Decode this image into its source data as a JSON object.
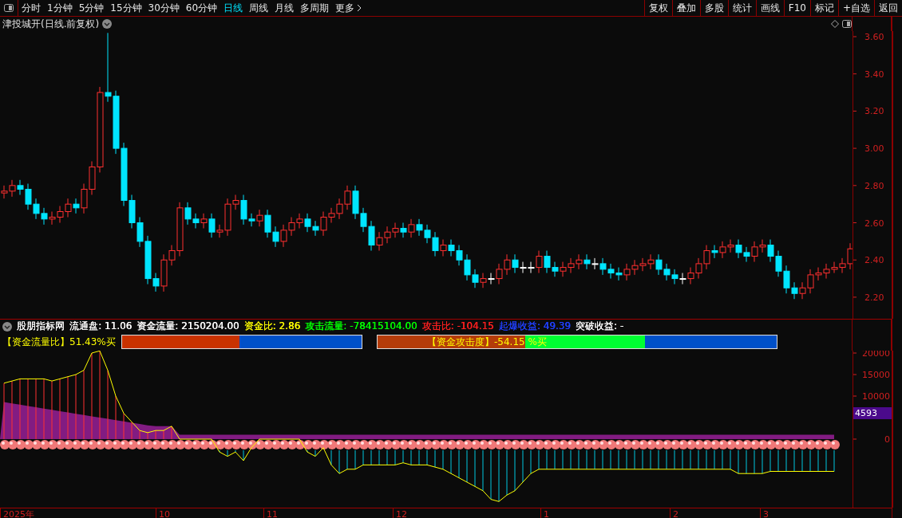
{
  "toolbar": {
    "tabs": [
      {
        "label": "分时",
        "selected": false
      },
      {
        "label": "1分钟",
        "selected": false
      },
      {
        "label": "5分钟",
        "selected": false
      },
      {
        "label": "15分钟",
        "selected": false
      },
      {
        "label": "30分钟",
        "selected": false
      },
      {
        "label": "60分钟",
        "selected": false
      },
      {
        "label": "日线",
        "selected": true
      },
      {
        "label": "周线",
        "selected": false
      },
      {
        "label": "月线",
        "selected": false
      },
      {
        "label": "多周期",
        "selected": false
      },
      {
        "label": "更多",
        "selected": false
      }
    ],
    "buttons": [
      "复权",
      "叠加",
      "多股",
      "统计",
      "画线",
      "F10",
      "标记",
      "+自选",
      "返回"
    ]
  },
  "chart": {
    "title": "津投城开(日线.前复权)",
    "chart_data": {
      "type": "candlestick",
      "ylim": [
        2.084,
        3.63
      ],
      "yticks": [
        {
          "value": 3.6,
          "label": "3.60"
        },
        {
          "value": 3.4,
          "label": "3.40"
        },
        {
          "value": 3.2,
          "label": "3.20"
        },
        {
          "value": 3.0,
          "label": "3.00"
        },
        {
          "value": 2.8,
          "label": "2.80"
        },
        {
          "value": 2.6,
          "label": "2.60"
        },
        {
          "value": 2.4,
          "label": "2.40"
        },
        {
          "value": 2.2,
          "label": "2.20"
        }
      ],
      "ohlc": [
        [
          2.76,
          2.8,
          2.73,
          2.77
        ],
        [
          2.77,
          2.83,
          2.74,
          2.8
        ],
        [
          2.8,
          2.83,
          2.75,
          2.78
        ],
        [
          2.78,
          2.81,
          2.67,
          2.7
        ],
        [
          2.7,
          2.73,
          2.62,
          2.65
        ],
        [
          2.65,
          2.68,
          2.59,
          2.62
        ],
        [
          2.62,
          2.66,
          2.59,
          2.63
        ],
        [
          2.63,
          2.69,
          2.6,
          2.66
        ],
        [
          2.66,
          2.73,
          2.63,
          2.7
        ],
        [
          2.7,
          2.73,
          2.65,
          2.68
        ],
        [
          2.68,
          2.81,
          2.65,
          2.78
        ],
        [
          2.78,
          2.93,
          2.75,
          2.9
        ],
        [
          2.9,
          3.33,
          2.87,
          3.3
        ],
        [
          3.3,
          3.62,
          3.25,
          3.28
        ],
        [
          3.28,
          3.31,
          2.97,
          3.0
        ],
        [
          3.0,
          3.03,
          2.69,
          2.72
        ],
        [
          2.72,
          2.75,
          2.57,
          2.6
        ],
        [
          2.6,
          2.63,
          2.47,
          2.5
        ],
        [
          2.5,
          2.53,
          2.27,
          2.3
        ],
        [
          2.3,
          2.33,
          2.23,
          2.26
        ],
        [
          2.26,
          2.43,
          2.23,
          2.4
        ],
        [
          2.4,
          2.48,
          2.37,
          2.45
        ],
        [
          2.45,
          2.71,
          2.42,
          2.68
        ],
        [
          2.68,
          2.71,
          2.59,
          2.62
        ],
        [
          2.62,
          2.65,
          2.57,
          2.6
        ],
        [
          2.6,
          2.65,
          2.57,
          2.62
        ],
        [
          2.62,
          2.65,
          2.52,
          2.55
        ],
        [
          2.55,
          2.59,
          2.52,
          2.56
        ],
        [
          2.56,
          2.73,
          2.53,
          2.7
        ],
        [
          2.7,
          2.75,
          2.67,
          2.72
        ],
        [
          2.72,
          2.75,
          2.59,
          2.62
        ],
        [
          2.62,
          2.65,
          2.58,
          2.61
        ],
        [
          2.61,
          2.67,
          2.58,
          2.64
        ],
        [
          2.64,
          2.67,
          2.52,
          2.55
        ],
        [
          2.55,
          2.58,
          2.47,
          2.5
        ],
        [
          2.5,
          2.59,
          2.47,
          2.56
        ],
        [
          2.56,
          2.63,
          2.53,
          2.6
        ],
        [
          2.6,
          2.65,
          2.57,
          2.62
        ],
        [
          2.62,
          2.65,
          2.55,
          2.58
        ],
        [
          2.58,
          2.61,
          2.53,
          2.56
        ],
        [
          2.56,
          2.66,
          2.53,
          2.63
        ],
        [
          2.63,
          2.68,
          2.6,
          2.65
        ],
        [
          2.65,
          2.73,
          2.62,
          2.7
        ],
        [
          2.7,
          2.8,
          2.67,
          2.77
        ],
        [
          2.77,
          2.8,
          2.62,
          2.65
        ],
        [
          2.65,
          2.68,
          2.55,
          2.58
        ],
        [
          2.58,
          2.61,
          2.45,
          2.48
        ],
        [
          2.48,
          2.55,
          2.45,
          2.52
        ],
        [
          2.52,
          2.58,
          2.49,
          2.55
        ],
        [
          2.55,
          2.6,
          2.52,
          2.57
        ],
        [
          2.57,
          2.6,
          2.52,
          2.55
        ],
        [
          2.55,
          2.62,
          2.52,
          2.59
        ],
        [
          2.59,
          2.62,
          2.53,
          2.56
        ],
        [
          2.56,
          2.59,
          2.49,
          2.52
        ],
        [
          2.52,
          2.55,
          2.42,
          2.45
        ],
        [
          2.45,
          2.51,
          2.42,
          2.48
        ],
        [
          2.48,
          2.51,
          2.42,
          2.45
        ],
        [
          2.45,
          2.48,
          2.37,
          2.4
        ],
        [
          2.4,
          2.43,
          2.29,
          2.32
        ],
        [
          2.32,
          2.35,
          2.25,
          2.28
        ],
        [
          2.28,
          2.33,
          2.25,
          2.3
        ],
        [
          2.3,
          2.33,
          2.27,
          2.3
        ],
        [
          2.3,
          2.38,
          2.27,
          2.35
        ],
        [
          2.35,
          2.43,
          2.32,
          2.4
        ],
        [
          2.4,
          2.43,
          2.33,
          2.36
        ],
        [
          2.36,
          2.39,
          2.33,
          2.36
        ],
        [
          2.36,
          2.39,
          2.33,
          2.36
        ],
        [
          2.36,
          2.45,
          2.33,
          2.42
        ],
        [
          2.42,
          2.45,
          2.33,
          2.36
        ],
        [
          2.36,
          2.39,
          2.31,
          2.34
        ],
        [
          2.34,
          2.39,
          2.31,
          2.36
        ],
        [
          2.36,
          2.41,
          2.33,
          2.38
        ],
        [
          2.38,
          2.43,
          2.35,
          2.4
        ],
        [
          2.4,
          2.43,
          2.35,
          2.38
        ],
        [
          2.38,
          2.41,
          2.35,
          2.38
        ],
        [
          2.38,
          2.41,
          2.32,
          2.35
        ],
        [
          2.35,
          2.38,
          2.3,
          2.33
        ],
        [
          2.33,
          2.36,
          2.29,
          2.32
        ],
        [
          2.32,
          2.38,
          2.29,
          2.35
        ],
        [
          2.35,
          2.4,
          2.32,
          2.37
        ],
        [
          2.37,
          2.41,
          2.34,
          2.38
        ],
        [
          2.38,
          2.43,
          2.35,
          2.4
        ],
        [
          2.4,
          2.43,
          2.32,
          2.35
        ],
        [
          2.35,
          2.38,
          2.29,
          2.32
        ],
        [
          2.32,
          2.35,
          2.27,
          2.3
        ],
        [
          2.3,
          2.33,
          2.27,
          2.3
        ],
        [
          2.3,
          2.36,
          2.27,
          2.33
        ],
        [
          2.33,
          2.41,
          2.3,
          2.38
        ],
        [
          2.38,
          2.48,
          2.35,
          2.45
        ],
        [
          2.45,
          2.48,
          2.41,
          2.44
        ],
        [
          2.44,
          2.5,
          2.41,
          2.47
        ],
        [
          2.47,
          2.51,
          2.44,
          2.48
        ],
        [
          2.48,
          2.51,
          2.41,
          2.44
        ],
        [
          2.44,
          2.47,
          2.39,
          2.42
        ],
        [
          2.42,
          2.5,
          2.39,
          2.47
        ],
        [
          2.47,
          2.51,
          2.44,
          2.48
        ],
        [
          2.48,
          2.51,
          2.39,
          2.42
        ],
        [
          2.42,
          2.45,
          2.31,
          2.34
        ],
        [
          2.34,
          2.37,
          2.22,
          2.25
        ],
        [
          2.25,
          2.28,
          2.19,
          2.22
        ],
        [
          2.22,
          2.28,
          2.19,
          2.25
        ],
        [
          2.25,
          2.35,
          2.22,
          2.32
        ],
        [
          2.32,
          2.36,
          2.29,
          2.33
        ],
        [
          2.33,
          2.38,
          2.3,
          2.35
        ],
        [
          2.35,
          2.39,
          2.33,
          2.36
        ],
        [
          2.36,
          2.41,
          2.33,
          2.38
        ],
        [
          2.38,
          2.49,
          2.35,
          2.46
        ]
      ]
    }
  },
  "indicator": {
    "items": [
      {
        "text": "股朋指标网",
        "color": "#ffffff"
      },
      {
        "text": "流通盘: 11.06",
        "color": "#ffffff"
      },
      {
        "text": "资金流量: 2150204.00",
        "color": "#ffffff"
      },
      {
        "text": "资金比: 2.86",
        "color": "#ffff00"
      },
      {
        "text": "攻击流量: -78415104.00",
        "color": "#00ff00"
      },
      {
        "text": "攻击比: -104.15",
        "color": "#ff2020"
      },
      {
        "text": "起爆收益: 49.39",
        "color": "#2040ff"
      },
      {
        "text": "突破收益: -",
        "color": "#ffffff"
      }
    ]
  },
  "flow_bar": {
    "label": "【资金流量比】51.43%买",
    "segments": [
      {
        "color": "#c83200",
        "level": 0.49
      },
      {
        "color": "#0050c8",
        "level": 0.51
      }
    ]
  },
  "attack_bar": {
    "label": "【资金攻击度】-54.15 %买",
    "segments": [
      {
        "color": "#b43c0a"
      },
      {
        "color": "#00ff32"
      },
      {
        "color": "#0050c8"
      }
    ]
  },
  "lower_chart": {
    "badge": "4593",
    "chart_data": {
      "type": "line",
      "ylim": [
        -15926,
        24630
      ],
      "categories": [
        null,
        null,
        null,
        null,
        null,
        null,
        null,
        null,
        null,
        null,
        null,
        null,
        null,
        null,
        null,
        null,
        null,
        null,
        null,
        null,
        null,
        null,
        null,
        null,
        null,
        null,
        null,
        null,
        null,
        null,
        null,
        null,
        null,
        null,
        null,
        null,
        null,
        null,
        null,
        null,
        null,
        null,
        null,
        null,
        null,
        null,
        null,
        null,
        null,
        null,
        null,
        null,
        null,
        null,
        null,
        null,
        null,
        null,
        null,
        null,
        null,
        null,
        null,
        null,
        null,
        null,
        null,
        null,
        null,
        null,
        null,
        null,
        null,
        null,
        null,
        null,
        null,
        null,
        null,
        null,
        null,
        null,
        null,
        null,
        null,
        null,
        null,
        null,
        null,
        null,
        null,
        null,
        null,
        null,
        null,
        null,
        null,
        null,
        null,
        null,
        null,
        null,
        null,
        null,
        null
      ],
      "yticks": [
        {
          "value": 20000,
          "label": "20000"
        },
        {
          "value": 15000,
          "label": "15000"
        },
        {
          "value": 10000,
          "label": "10000"
        },
        {
          "value": 0,
          "label": "0"
        }
      ],
      "series": [
        {
          "color": "#ffff00",
          "values": [
            13000,
            13500,
            14000,
            14000,
            14000,
            14000,
            13500,
            14000,
            14500,
            15000,
            16000,
            20000,
            20500,
            16000,
            10000,
            6000,
            4000,
            2000,
            1500,
            2000,
            2000,
            3000,
            0,
            0,
            0,
            0,
            0,
            -3000,
            -4000,
            -3000,
            -5000,
            -2000,
            0,
            0,
            0,
            0,
            0,
            0,
            -3000,
            -4000,
            -2000,
            -6000,
            -8000,
            -7000,
            -7000,
            -6000,
            -6000,
            -6000,
            -6000,
            -6000,
            -5500,
            -6000,
            -6000,
            -6000,
            -6500,
            -7000,
            -8000,
            -9000,
            -10000,
            -11000,
            -12000,
            -14000,
            -14500,
            -13000,
            -12000,
            -10000,
            -8000,
            -7000,
            -7000,
            -7000,
            -7000,
            -7000,
            -7000,
            -7000,
            -7000,
            -7000,
            -7000,
            -7000,
            -7000,
            -7000,
            -7000,
            -7000,
            -7000,
            -7000,
            -7000,
            -7000,
            -7000,
            -7000,
            -7000,
            -7000,
            -7000,
            -7000,
            -8000,
            -8000,
            -8000,
            -8000,
            -7500,
            -7500,
            -7500,
            -7500,
            -7500,
            -7500,
            -7500,
            -7500,
            -7500
          ]
        }
      ]
    }
  },
  "date_axis": [
    "2025年",
    "10",
    "11",
    "12",
    "1",
    "2",
    "3"
  ]
}
